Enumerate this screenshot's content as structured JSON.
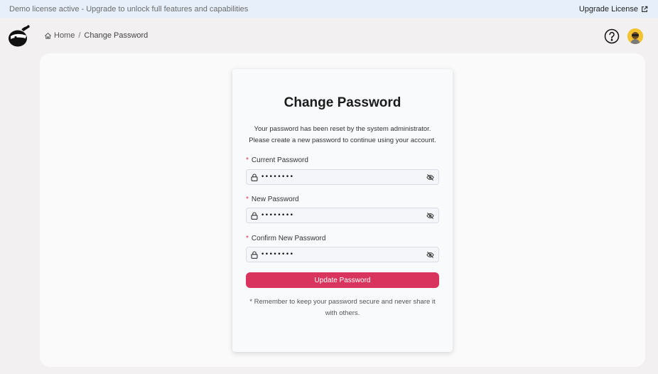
{
  "banner": {
    "message": "Demo license active - Upgrade to unlock full features and capabilities",
    "upgrade_label": "Upgrade License"
  },
  "breadcrumb": {
    "home": "Home",
    "separator": "/",
    "current": "Change Password"
  },
  "icons": {
    "logo": "ninja-logo-icon",
    "home": "home-icon",
    "help": "help-circle-icon",
    "avatar": "user-avatar",
    "lock": "lock-icon",
    "eye": "eye-off-icon",
    "external": "external-link-icon"
  },
  "form": {
    "title": "Change Password",
    "description_line1": "Your password has been reset by the system administrator.",
    "description_line2": "Please create a new password to continue using your account.",
    "required_marker": "*",
    "fields": [
      {
        "label": "Current Password",
        "value": "••••••••"
      },
      {
        "label": "New Password",
        "value": "••••••••"
      },
      {
        "label": "Confirm New Password",
        "value": "••••••••"
      }
    ],
    "submit_label": "Update Password",
    "note": "* Remember to keep your password secure and never share it with others."
  },
  "colors": {
    "accent": "#d9345e",
    "banner_bg": "#e7f0fa",
    "page_bg": "#f2f0f0"
  }
}
